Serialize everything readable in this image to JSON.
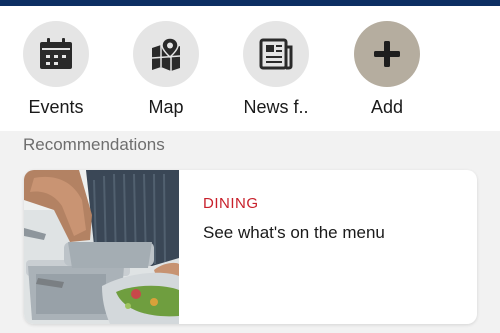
{
  "shortcuts": [
    {
      "label": "Events",
      "icon": "calendar-icon"
    },
    {
      "label": "Map",
      "icon": "map-icon"
    },
    {
      "label": "News f..",
      "icon": "newspaper-icon"
    },
    {
      "label": "Add",
      "icon": "plus-icon"
    }
  ],
  "recommendations": {
    "title": "Recommendations",
    "cards": [
      {
        "category": "DINING",
        "title": "See what's on the menu",
        "image": "chef-cooking-photo"
      }
    ]
  },
  "colors": {
    "topbar": "#0d2f63",
    "category": "#c8202b",
    "add_circle": "#b5ad9f",
    "icon_circle": "#e5e5e5"
  }
}
